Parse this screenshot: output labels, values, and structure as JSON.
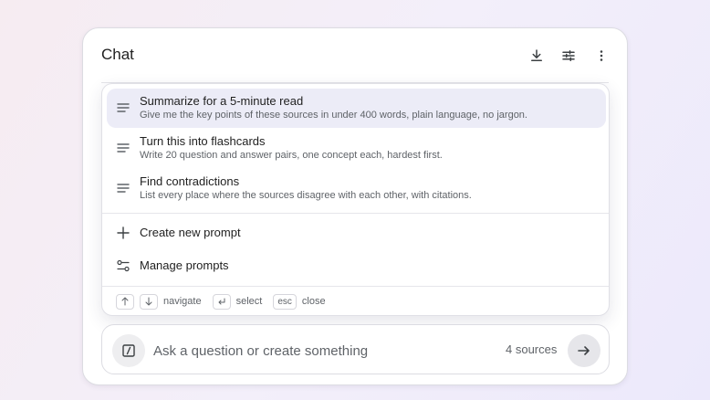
{
  "header": {
    "title": "Chat",
    "icons": [
      "download-icon",
      "tune-icon",
      "more-vert-icon"
    ]
  },
  "prompts": [
    {
      "title": "Summarize for a 5-minute read",
      "description": "Give me the key points of these sources in under 400 words, plain language, no jargon.",
      "icon": "lines-icon",
      "active": true
    },
    {
      "title": "Turn this into flashcards",
      "description": "Write 20 question and answer pairs, one concept each, hardest first.",
      "icon": "lines-icon",
      "active": false
    },
    {
      "title": "Find contradictions",
      "description": "List every place where the sources disagree with each other, with citations.",
      "icon": "lines-icon",
      "active": false
    }
  ],
  "actions": [
    {
      "label": "Create new prompt",
      "icon": "plus-icon"
    },
    {
      "label": "Manage prompts",
      "icon": "sliders-icon"
    }
  ],
  "hints": [
    {
      "keys": [
        "up-arrow-icon",
        "down-arrow-icon"
      ],
      "label": "navigate"
    },
    {
      "keys": [
        "enter-icon"
      ],
      "label": "select"
    },
    {
      "keys": [
        "esc"
      ],
      "label": "close"
    }
  ],
  "composer": {
    "placeholder": "Ask a question or create something",
    "value": "",
    "sources_label": "4 sources",
    "colors": {
      "accent_active_row": "#ececf7",
      "muted_text": "#5f6368"
    }
  }
}
